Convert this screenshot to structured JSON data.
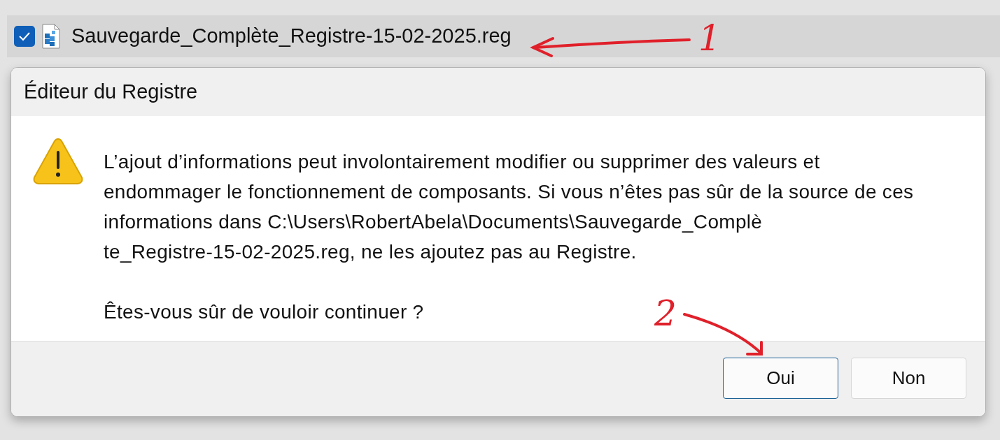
{
  "file_row": {
    "checked": true,
    "filename": "Sauvegarde_Complète_Registre-15-02-2025.reg"
  },
  "dialog": {
    "title": "Éditeur du Registre",
    "message_lines": [
      "L’ajout d’informations peut involontairement modifier ou supprimer des valeurs et",
      "endommager le fonctionnement de composants. Si vous n’êtes pas sûr de la source de ces",
      "informations dans C:\\Users\\RobertAbela\\Documents\\Sauvegarde_Complè",
      "te_Registre-15-02-2025.reg, ne les ajoutez pas au Registre."
    ],
    "question": "Êtes-vous sûr de vouloir continuer ?",
    "buttons": [
      {
        "label": "Oui",
        "selected": true
      },
      {
        "label": "Non",
        "selected": false
      }
    ]
  },
  "annotations": [
    {
      "label": "1"
    },
    {
      "label": "2"
    }
  ]
}
